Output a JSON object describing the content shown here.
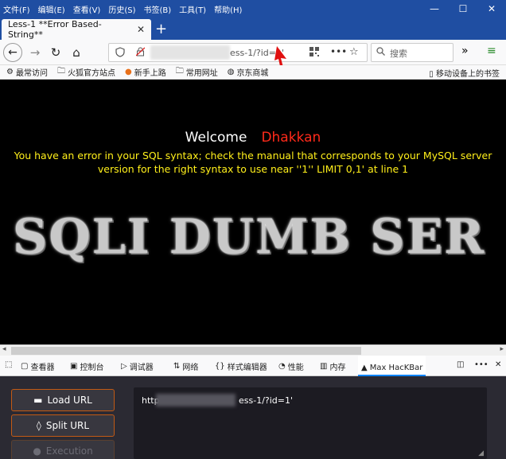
{
  "menubar": [
    "文件(F)",
    "编辑(E)",
    "查看(V)",
    "历史(S)",
    "书签(B)",
    "工具(T)",
    "帮助(H)"
  ],
  "window_controls": {
    "minimize": "—",
    "maximize": "☐",
    "close": "✕"
  },
  "tab": {
    "title": "Less-1 **Error Based- String**",
    "close": "✕",
    "new_tab": "+"
  },
  "nav": {
    "back": "←",
    "forward": "→",
    "reload": "↻",
    "home": "⌂",
    "url_visible": "ess-1/?id=1'",
    "url_more": "•••",
    "bookmark_star": "☆",
    "search_placeholder": "搜索",
    "overflow": "»",
    "menu": "≡"
  },
  "bookmarks": {
    "items": [
      "最常访问",
      "火狐官方站点",
      "新手上路",
      "常用网址",
      "京东商城"
    ],
    "mobile": "移动设备上的书签"
  },
  "page": {
    "welcome": "Welcome",
    "name": "Dhakkan",
    "error": "You have an error in your SQL syntax; check the manual that corresponds to your MySQL server version for the right syntax to use near ''1'' LIMIT 0,1' at line 1",
    "banner": "SQLI DUMB SER"
  },
  "devtools": {
    "tabs": [
      "查看器",
      "控制台",
      "调试器",
      "网络",
      "样式编辑器",
      "性能",
      "内存",
      "Max HacKBar"
    ],
    "more": "•••",
    "close": "✕"
  },
  "hackbar": {
    "load_url": "Load URL",
    "split_url": "Split URL",
    "execution": "Execution",
    "url_prefix": "http",
    "url_suffix": "ess-1/?id=1'"
  },
  "colors": {
    "welcome_name": "#ff2a1a",
    "error_text": "#ffef1a",
    "titlebar": "#1f4ea2",
    "button_border": "#c25a14"
  }
}
